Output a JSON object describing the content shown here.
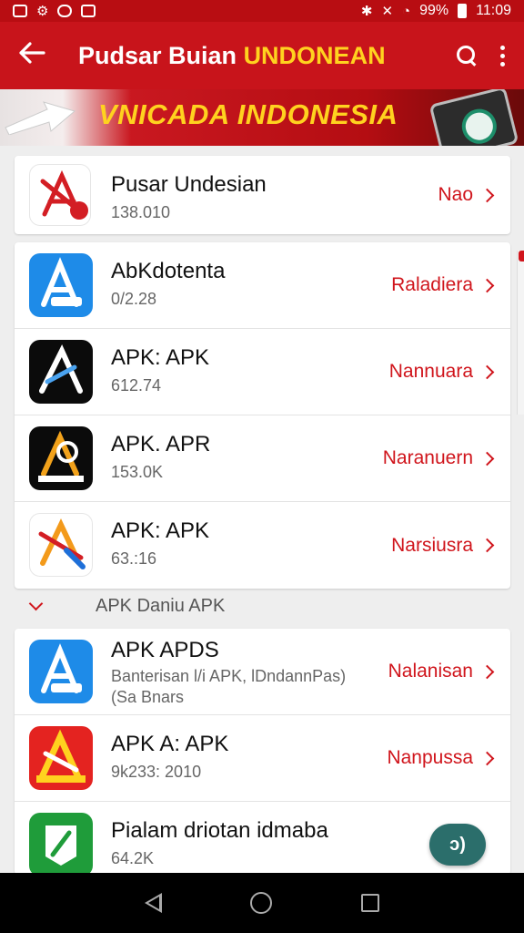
{
  "status_bar": {
    "time": "11:09",
    "battery": "99%"
  },
  "app_bar": {
    "title_main": "Pudsar Buian",
    "title_accent": "UNDONEAN"
  },
  "banner": {
    "text": "VNICADA INDONESIA"
  },
  "featured": {
    "title": "Pusar Undesian",
    "subtitle": "138.010",
    "action": "Nao"
  },
  "list1": [
    {
      "title": "AbKdotenta",
      "subtitle": "0/2.28",
      "action": "Raladiera"
    },
    {
      "title": "APK: APK",
      "subtitle": "612.74",
      "action": "Nannuara"
    },
    {
      "title": "APK. APR",
      "subtitle": "153.0K",
      "action": "Naranuern"
    },
    {
      "title": "APK: APK",
      "subtitle": "63.:16",
      "action": "Narsiusra"
    }
  ],
  "section": {
    "label": "APK Daniu APK"
  },
  "list2": [
    {
      "title": "APK APDS",
      "subtitle": "Banterisan l/i APK, lDndannPas)",
      "subtitle2": "(Sa Bnars",
      "action": "Nalanisan"
    },
    {
      "title": "APK A: APK",
      "subtitle": "9k233: 2010",
      "action": "Nanpussa"
    },
    {
      "title": "Pialam driotan idmaba",
      "subtitle": "64.2K"
    }
  ],
  "fab": {
    "label": "ↄ)"
  },
  "colors": {
    "brand_red": "#c8141b",
    "accent_yellow": "#ffd21f",
    "action_red": "#d0151c"
  }
}
